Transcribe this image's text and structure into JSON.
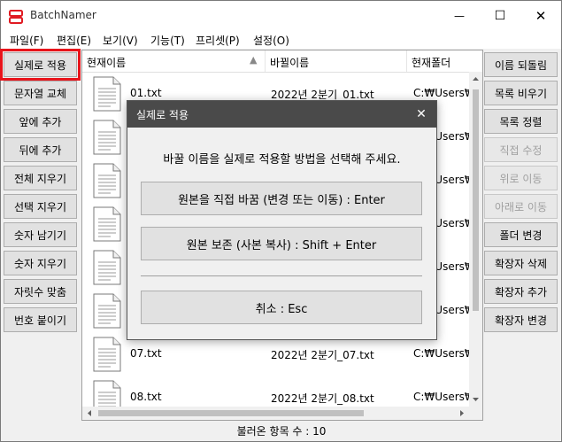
{
  "window": {
    "title": "BatchNamer",
    "controls": {
      "minimize": "—",
      "maximize": "☐",
      "close": "✕"
    }
  },
  "menu": [
    "파일(F)",
    "편집(E)",
    "보기(V)",
    "기능(T)",
    "프리셋(P)",
    "설정(O)"
  ],
  "left_buttons": [
    {
      "label": "실제로 적용",
      "highlighted": true
    },
    {
      "label": "문자열 교체"
    },
    {
      "label": "앞에 추가"
    },
    {
      "label": "뒤에 추가"
    },
    {
      "label": "전체 지우기"
    },
    {
      "label": "선택 지우기"
    },
    {
      "label": "숫자 남기기"
    },
    {
      "label": "숫자 지우기"
    },
    {
      "label": "자릿수 맞춤"
    },
    {
      "label": "번호 붙이기"
    }
  ],
  "right_buttons": [
    {
      "label": "이름 되돌림",
      "disabled": false
    },
    {
      "label": "목록 비우기",
      "disabled": false
    },
    {
      "label": "목록 정렬",
      "disabled": false
    },
    {
      "label": "직접 수정",
      "disabled": true
    },
    {
      "label": "위로 이동",
      "disabled": true
    },
    {
      "label": "아래로 이동",
      "disabled": true
    },
    {
      "label": "폴더 변경",
      "disabled": false
    },
    {
      "label": "확장자 삭제",
      "disabled": false
    },
    {
      "label": "확장자 추가",
      "disabled": false
    },
    {
      "label": "확장자 변경",
      "disabled": false
    }
  ],
  "list": {
    "columns": [
      "현재이름",
      "바뀔이름",
      "현재폴더"
    ],
    "sort_indicator": "▲",
    "rows": [
      {
        "current": "01.txt",
        "new": "2022년 2분기_01.txt",
        "folder": "C:₩Users₩"
      },
      {
        "current": "",
        "new": "",
        "folder": "C:₩Users₩"
      },
      {
        "current": "",
        "new": "",
        "folder": "C:₩Users₩"
      },
      {
        "current": "",
        "new": "",
        "folder": "C:₩Users₩"
      },
      {
        "current": "",
        "new": "",
        "folder": "C:₩Users₩"
      },
      {
        "current": "",
        "new": "",
        "folder": "C:₩Users₩"
      },
      {
        "current": "07.txt",
        "new": "2022년 2분기_07.txt",
        "folder": "C:₩Users₩"
      },
      {
        "current": "08.txt",
        "new": "2022년 2분기_08.txt",
        "folder": "C:₩Users₩"
      }
    ]
  },
  "status": "불러온 항목 수 : 10",
  "dialog": {
    "title": "실제로 적용",
    "message": "바꿀 이름을 실제로 적용할 방법을 선택해 주세요.",
    "options": [
      "원본을 직접 바꿈 (변경 또는 이동) : Enter",
      "원본 보존 (사본 복사) : Shift + Enter",
      "취소 : Esc"
    ],
    "close": "✕"
  },
  "colors": {
    "highlight": "#e8141b",
    "dialog_title_bg": "#4a4a4a"
  }
}
